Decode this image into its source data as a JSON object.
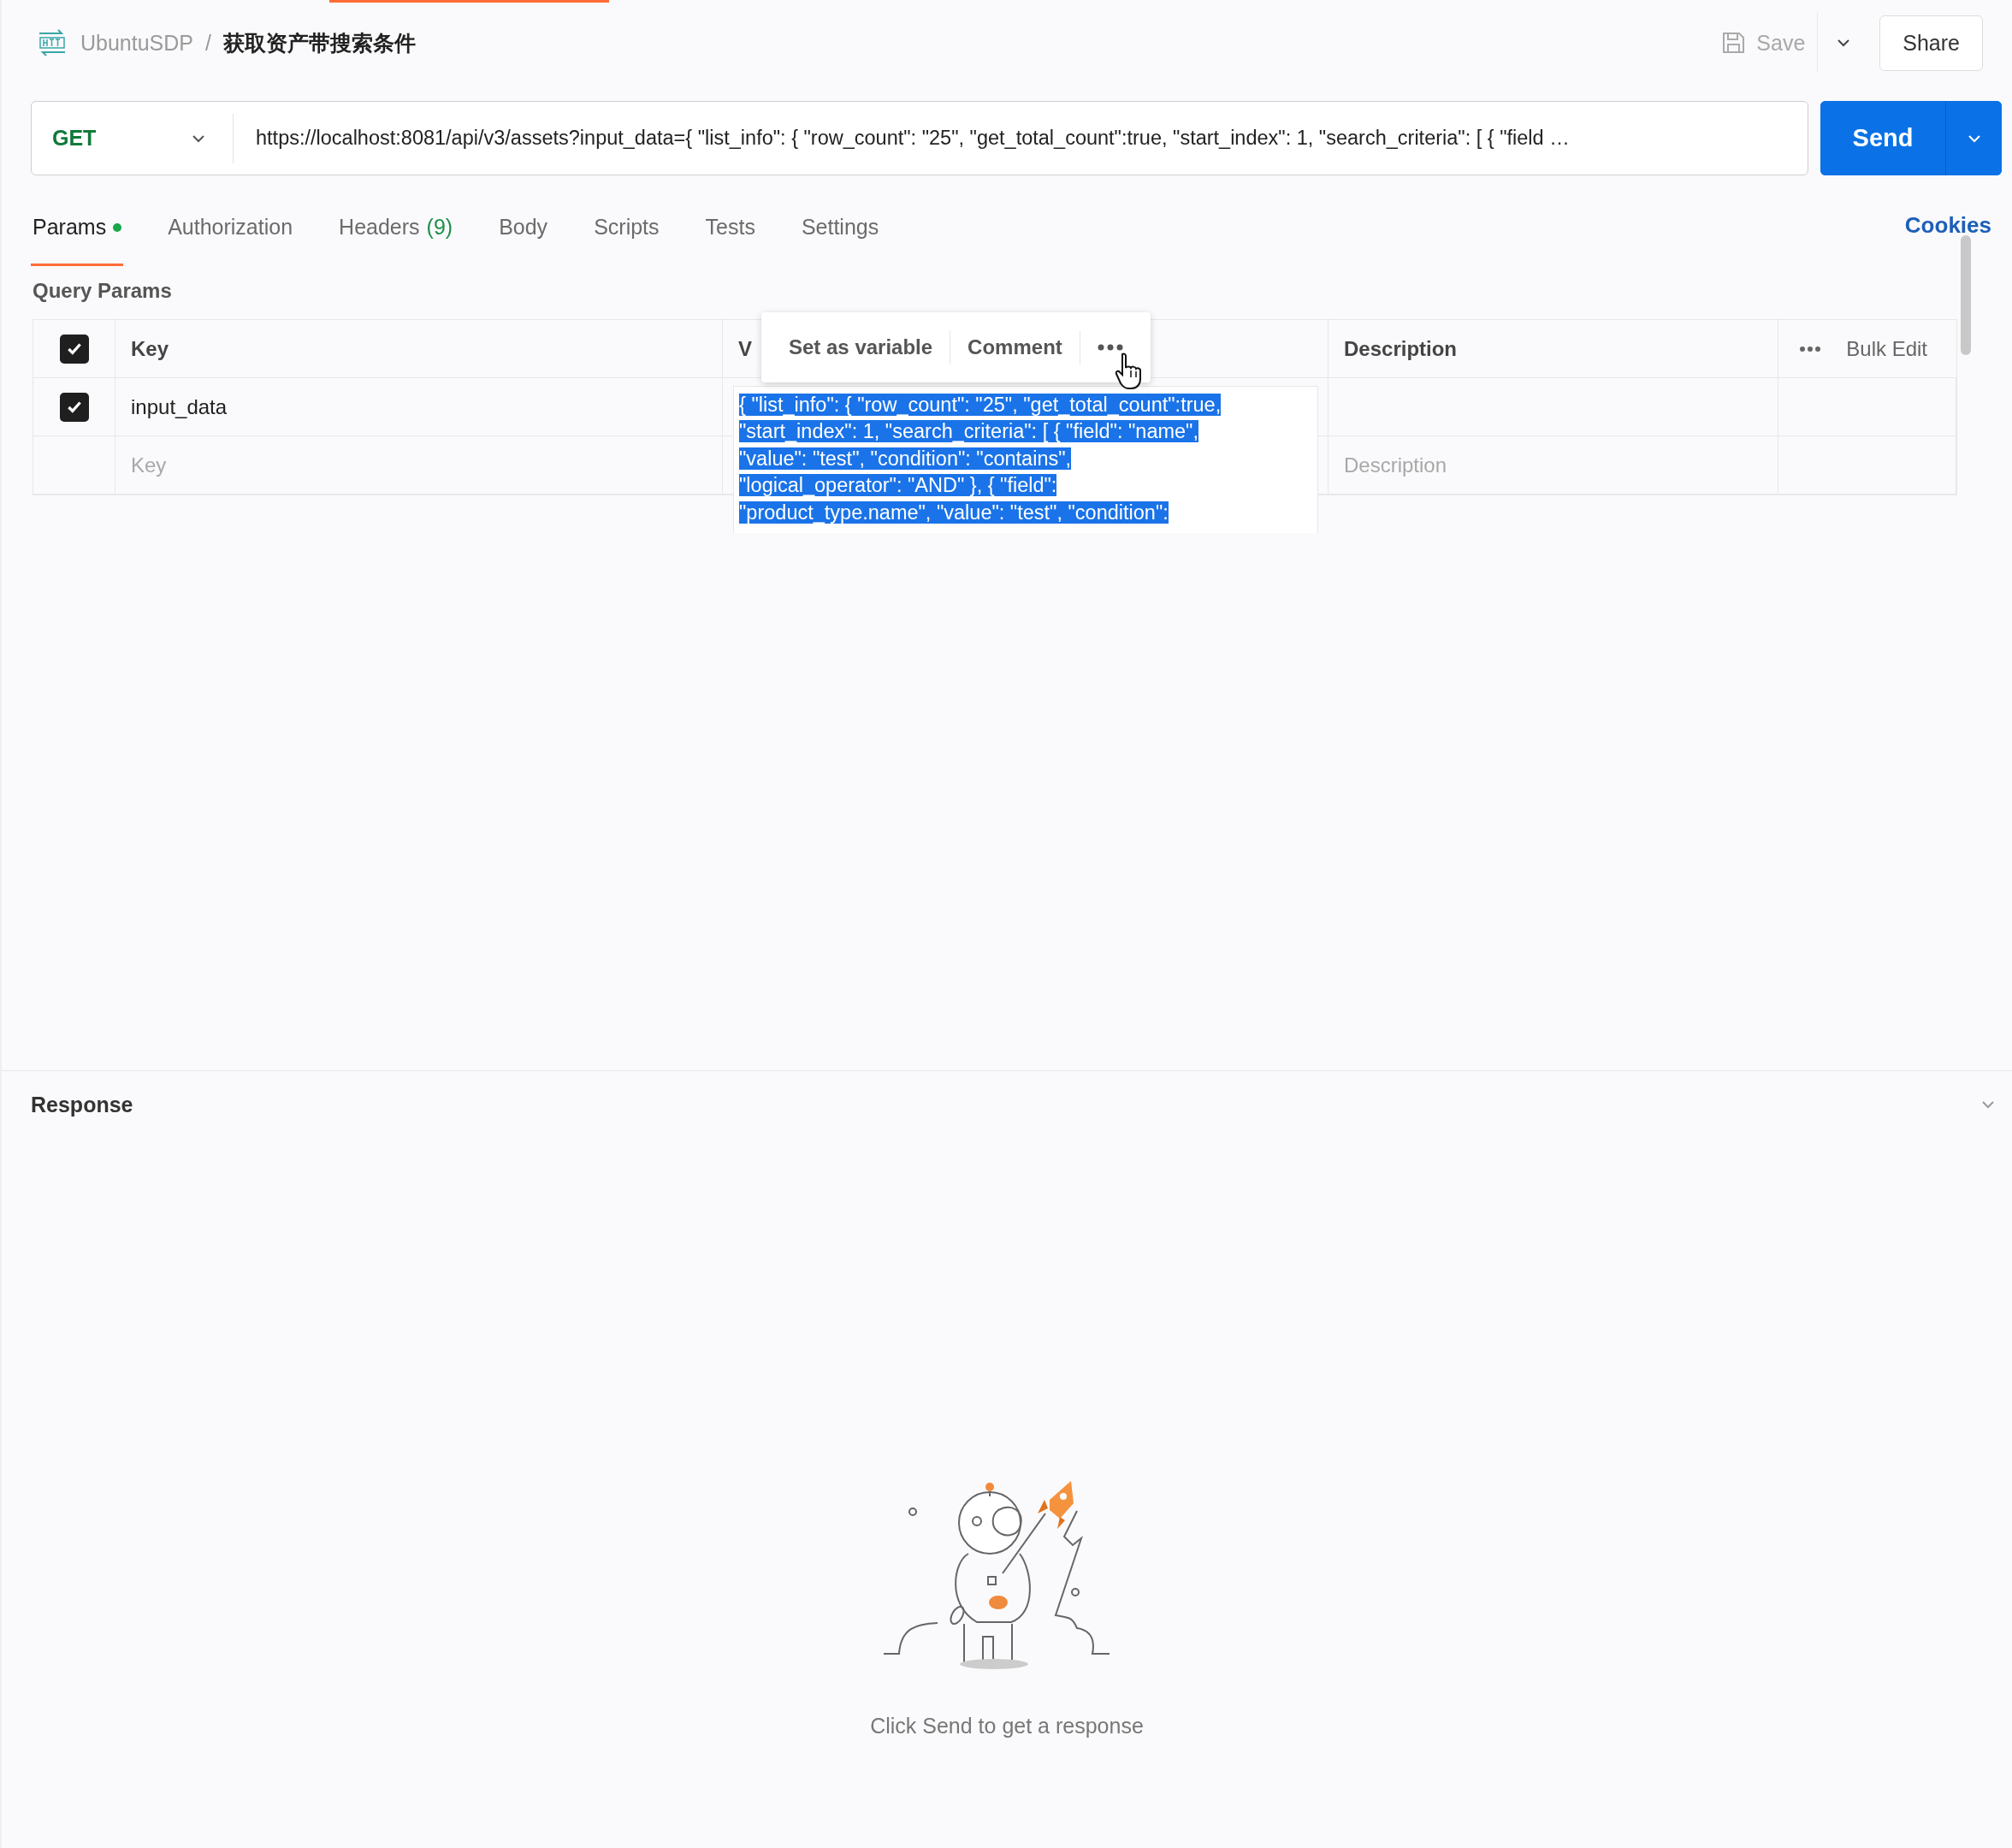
{
  "breadcrumb": {
    "collection": "UbuntuSDP",
    "separator": "/",
    "request": "获取资产带搜索条件"
  },
  "actions": {
    "save": "Save",
    "share": "Share"
  },
  "request": {
    "method": "GET",
    "url": "https://localhost:8081/api/v3/assets?input_data={ \"list_info\": { \"row_count\": \"25\", \"get_total_count\":true, \"start_index\": 1, \"search_criteria\": [ { \"field …",
    "send": "Send"
  },
  "tabs": [
    {
      "label": "Params",
      "selected": true,
      "dot": true
    },
    {
      "label": "Authorization",
      "selected": false,
      "dot": false
    },
    {
      "label": "Headers",
      "count": "(9)",
      "selected": false,
      "dot": false
    },
    {
      "label": "Body",
      "selected": false,
      "dot": false
    },
    {
      "label": "Scripts",
      "selected": false,
      "dot": false
    },
    {
      "label": "Tests",
      "selected": false,
      "dot": false
    },
    {
      "label": "Settings",
      "selected": false,
      "dot": false
    }
  ],
  "cookies": "Cookies",
  "query_params": {
    "title": "Query Params",
    "select_all_checked": true,
    "key_header": "Key",
    "value_header": "V",
    "description_header": "Description",
    "bulk_edit": "Bulk Edit",
    "rows": [
      {
        "checked": true,
        "key": "input_data",
        "value_lines": [
          "{ \"list_info\": { \"row_count\": \"25\", \"get_total_count\":true,",
          "\"start_index\": 1, \"search_criteria\": [ { \"field\": \"name\",",
          "\"value\": \"test\", \"condition\": \"contains\",",
          "\"logical_operator\": \"AND\" }, { \"field\":",
          "\"product_type.name\", \"value\": \"test\", \"condition\":"
        ]
      }
    ],
    "empty_row": {
      "key_placeholder": "Key",
      "description_placeholder": "Description"
    }
  },
  "popover": {
    "items": [
      "Set as variable",
      "Comment"
    ]
  },
  "response": {
    "title": "Response",
    "empty_message": "Click Send to get a response"
  }
}
